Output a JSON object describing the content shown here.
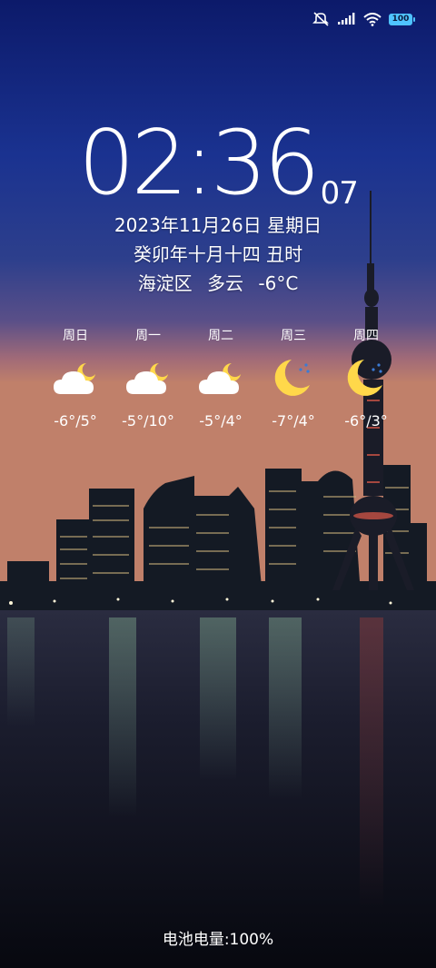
{
  "status": {
    "battery": "100",
    "icons": [
      "mute-icon",
      "signal-icon",
      "wifi-icon",
      "battery-icon"
    ],
    "accent_color": "#4fc3ff"
  },
  "clock": {
    "time": "02:36",
    "seconds": "07"
  },
  "date": {
    "gregorian": "2023年11月26日 星期日",
    "lunar": "癸卯年十月十四 丑时"
  },
  "current_weather": {
    "district": "海淀区",
    "condition": "多云",
    "temperature": "-6°C"
  },
  "forecast": [
    {
      "day": "周日",
      "icon": "partly-cloudy-night-icon",
      "temps": "-6°/5°"
    },
    {
      "day": "周一",
      "icon": "partly-cloudy-night-icon",
      "temps": "-5°/10°"
    },
    {
      "day": "周二",
      "icon": "partly-cloudy-night-icon",
      "temps": "-5°/4°"
    },
    {
      "day": "周三",
      "icon": "clear-night-icon",
      "temps": "-7°/4°"
    },
    {
      "day": "周四",
      "icon": "clear-night-icon",
      "temps": "-6°/3°"
    }
  ],
  "footer": {
    "battery_text": "电池电量:100%"
  }
}
